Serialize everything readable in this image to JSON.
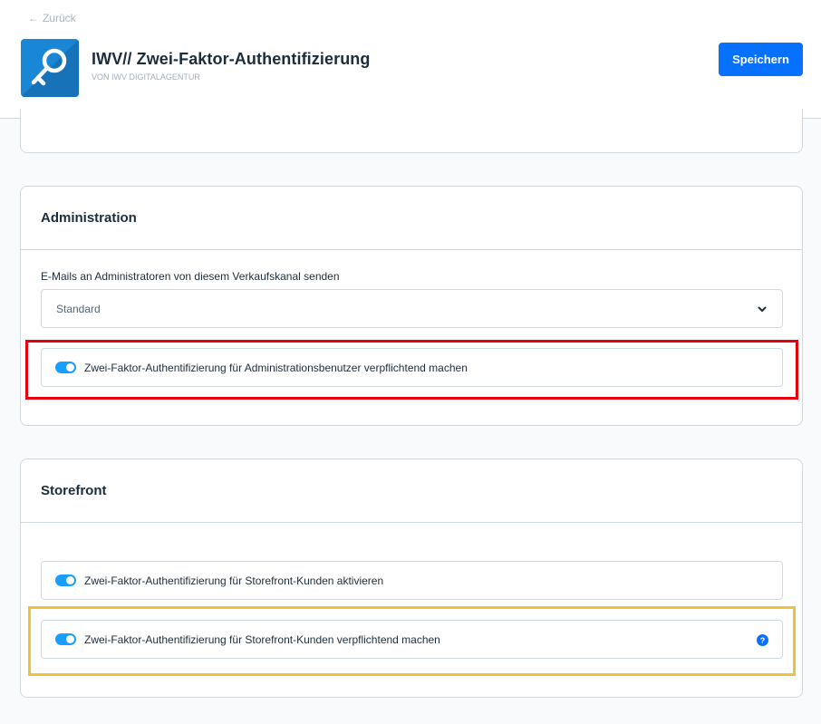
{
  "header": {
    "back_label": "Zurück",
    "title": "IWV// Zwei-Faktor-Authentifizierung",
    "vendor": "von IWV DIGITALAGENTUR",
    "save_label": "Speichern",
    "icon": "key-icon",
    "brand_color": "#0870ff"
  },
  "administration": {
    "title": "Administration",
    "email_label": "E-Mails an Administratoren von diesem Verkaufskanal senden",
    "email_select_value": "Standard",
    "mandatory_2fa_label": "Zwei-Faktor-Authentifizierung für Administrationsbenutzer verpflichtend machen",
    "mandatory_2fa_enabled": true
  },
  "storefront": {
    "title": "Storefront",
    "enable_label": "Zwei-Faktor-Authentifizierung für Storefront-Kunden aktivieren",
    "enable_enabled": true,
    "mandatory_label": "Zwei-Faktor-Authentifizierung für Storefront-Kunden verpflichtend machen",
    "mandatory_enabled": true,
    "help_icon": "?"
  },
  "highlights": {
    "admin_color": "#e5000b",
    "storefront_color": "#eac43d"
  }
}
